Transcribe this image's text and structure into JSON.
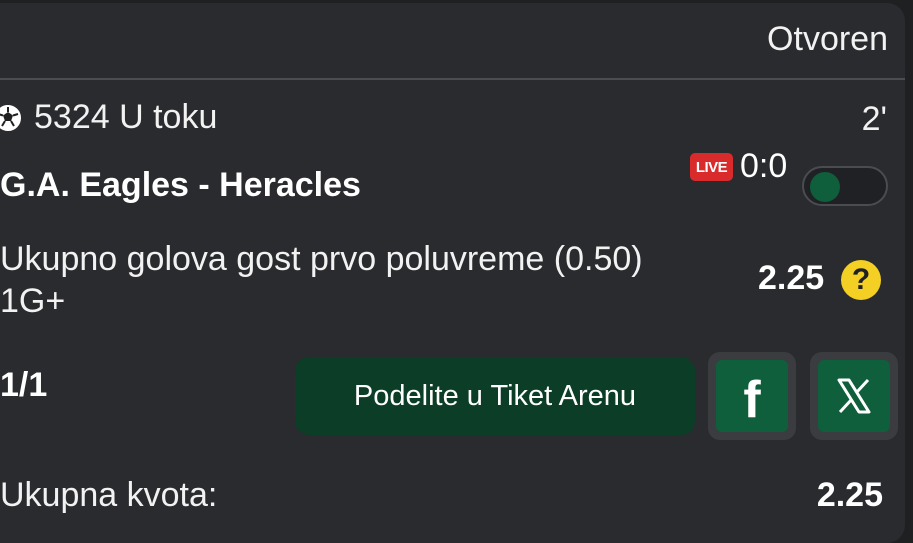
{
  "ticket": {
    "status": "Otvoren"
  },
  "event": {
    "id_status": "5324 U toku",
    "minute": "2'",
    "match": "G.A. Eagles - Heracles",
    "live_badge": "LIVE",
    "score": "0:0",
    "sport_icon": "soccer-ball-icon"
  },
  "selection": {
    "market": "Ukupno golova gost prvo poluvreme (0.50)",
    "pick": "1G+",
    "odds": "2.25",
    "help_symbol": "?"
  },
  "footer": {
    "count": "1/1",
    "share_label": "Podelite u Tiket Arenu",
    "facebook_icon": "f",
    "total_label": "Ukupna kvota:",
    "total_value": "2.25"
  },
  "colors": {
    "accent_green": "#0f5e3c",
    "share_bg": "#0b3d27",
    "live_red": "#d92b2b",
    "help_yellow": "#f4d024"
  }
}
